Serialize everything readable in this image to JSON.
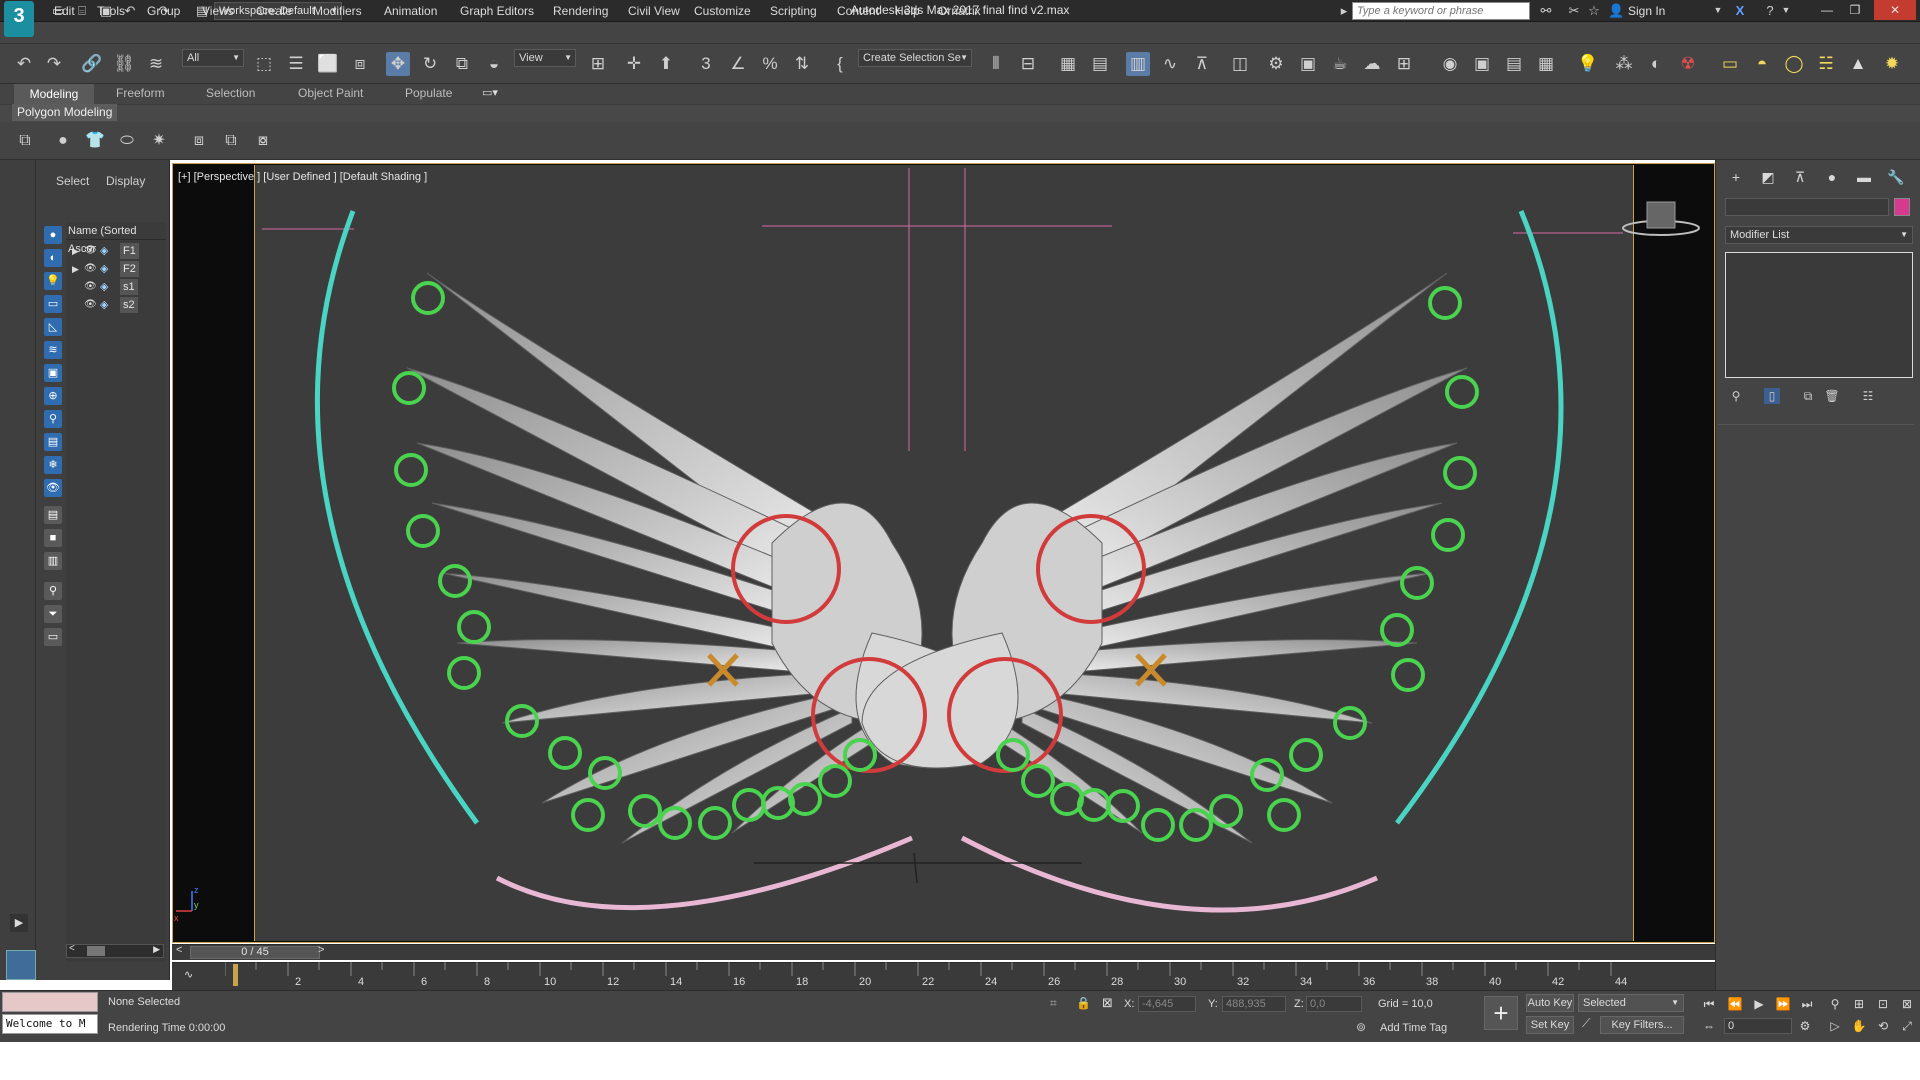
{
  "app": {
    "logo": "3",
    "workspace_label": "Workspace: Default",
    "title": "Autodesk 3ds Max 2017     final find v2.max",
    "search_placeholder": "Type a keyword or phrase",
    "sign_in": "Sign In"
  },
  "menu": [
    "Edit",
    "Tools",
    "Group",
    "Views",
    "Create",
    "Modifiers",
    "Animation",
    "Graph Editors",
    "Rendering",
    "Civil View",
    "Customize",
    "Scripting",
    "Content",
    "Help",
    "Ornatrix"
  ],
  "toolbar": {
    "selection_filter": "All",
    "reference_coord": "View",
    "named_selection": "Create Selection Se"
  },
  "ribbon": {
    "tabs": [
      "Modeling",
      "Freeform",
      "Selection",
      "Object Paint",
      "Populate"
    ],
    "panel_label": "Polygon Modeling"
  },
  "scene_explorer": {
    "tabs": [
      "Select",
      "Display"
    ],
    "column_header": "Name (Sorted Ascer",
    "items": [
      {
        "name": "F1",
        "expandable": true
      },
      {
        "name": "F2",
        "expandable": true
      },
      {
        "name": "s1",
        "expandable": false
      },
      {
        "name": "s2",
        "expandable": false
      }
    ]
  },
  "viewport": {
    "label": "[+] [Perspective ] [User Defined ] [Default Shading ]",
    "gizmo_x": "x",
    "gizmo_y": "y",
    "gizmo_z": "z"
  },
  "timeline": {
    "frame_display": "0 / 45",
    "ticks": [
      "2",
      "4",
      "6",
      "8",
      "10",
      "12",
      "14",
      "16",
      "18",
      "20",
      "22",
      "24",
      "26",
      "28",
      "30",
      "32",
      "34",
      "36",
      "38",
      "40",
      "42",
      "44"
    ]
  },
  "status": {
    "maxscript_text": "Welcome to M",
    "selection_status": "None Selected",
    "rendering_time": "Rendering Time  0:00:00",
    "x_label": "X:",
    "x_value": "-4,645",
    "y_label": "Y:",
    "y_value": "488,935",
    "z_label": "Z:",
    "z_value": "0,0",
    "grid": "Grid = 10,0",
    "add_time_tag": "Add Time Tag",
    "auto_key": "Auto Key",
    "set_key": "Set Key",
    "selected_dropdown": "Selected",
    "key_filters": "Key Filters...",
    "current_frame": "0"
  },
  "command_panel": {
    "modifier_list": "Modifier List",
    "object_color": "#d63a8e"
  }
}
